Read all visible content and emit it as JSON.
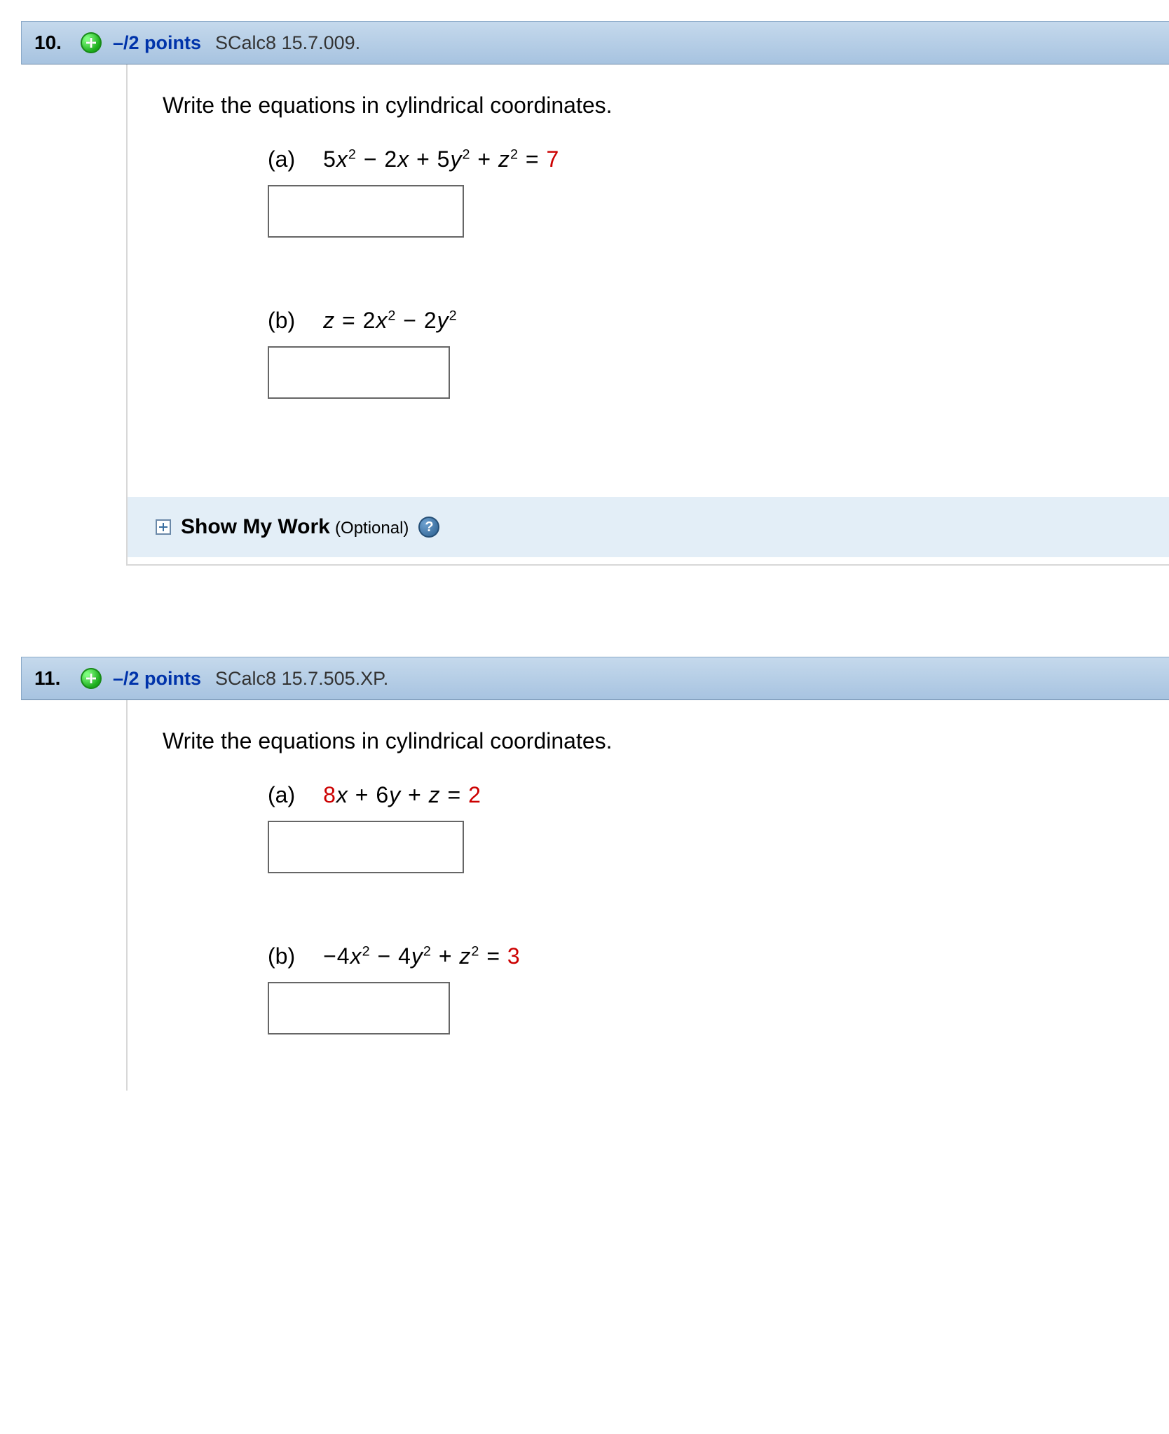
{
  "questions": [
    {
      "number": "10.",
      "points": "–/2 points",
      "qid": "SCalc8 15.7.009.",
      "prompt": "Write the equations in cylindrical coordinates.",
      "parts": [
        {
          "label": "(a)",
          "equation_html": "<span class='n'>5</span>x<sup>2</sup> <span class='n'>− 2</span>x <span class='n'>+ 5</span>y<sup>2</sup> <span class='n'>+</span> z<sup>2</sup> <span class='n'>=</span> <span class='n red'>7</span>"
        },
        {
          "label": "(b)",
          "equation_html": "z <span class='n'>= 2</span>x<sup>2</sup> <span class='n'>− 2</span>y<sup>2</sup>"
        }
      ],
      "show_work": {
        "label": "Show My Work",
        "optional": "(Optional)",
        "help": "?"
      }
    },
    {
      "number": "11.",
      "points": "–/2 points",
      "qid": "SCalc8 15.7.505.XP.",
      "prompt": "Write the equations in cylindrical coordinates.",
      "parts": [
        {
          "label": "(a)",
          "equation_html": "<span class='n red'>8</span>x <span class='n'>+ 6</span>y <span class='n'>+</span> z <span class='n'>=</span> <span class='n red'>2</span>"
        },
        {
          "label": "(b)",
          "equation_html": "<span class='n'>−4</span>x<sup>2</sup> <span class='n'>− 4</span>y<sup>2</sup> <span class='n'>+</span> z<sup>2</sup> <span class='n'>=</span> <span class='n red'>3</span>"
        }
      ]
    }
  ]
}
